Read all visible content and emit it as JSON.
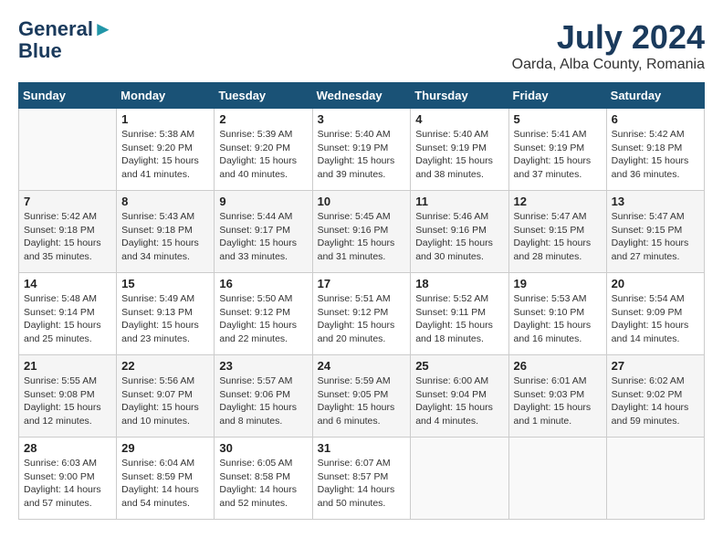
{
  "header": {
    "logo_line1": "General",
    "logo_line2": "Blue",
    "main_title": "July 2024",
    "subtitle": "Oarda, Alba County, Romania"
  },
  "days_of_week": [
    "Sunday",
    "Monday",
    "Tuesday",
    "Wednesday",
    "Thursday",
    "Friday",
    "Saturday"
  ],
  "weeks": [
    [
      {
        "day": "",
        "info": ""
      },
      {
        "day": "1",
        "info": "Sunrise: 5:38 AM\nSunset: 9:20 PM\nDaylight: 15 hours\nand 41 minutes."
      },
      {
        "day": "2",
        "info": "Sunrise: 5:39 AM\nSunset: 9:20 PM\nDaylight: 15 hours\nand 40 minutes."
      },
      {
        "day": "3",
        "info": "Sunrise: 5:40 AM\nSunset: 9:19 PM\nDaylight: 15 hours\nand 39 minutes."
      },
      {
        "day": "4",
        "info": "Sunrise: 5:40 AM\nSunset: 9:19 PM\nDaylight: 15 hours\nand 38 minutes."
      },
      {
        "day": "5",
        "info": "Sunrise: 5:41 AM\nSunset: 9:19 PM\nDaylight: 15 hours\nand 37 minutes."
      },
      {
        "day": "6",
        "info": "Sunrise: 5:42 AM\nSunset: 9:18 PM\nDaylight: 15 hours\nand 36 minutes."
      }
    ],
    [
      {
        "day": "7",
        "info": "Sunrise: 5:42 AM\nSunset: 9:18 PM\nDaylight: 15 hours\nand 35 minutes."
      },
      {
        "day": "8",
        "info": "Sunrise: 5:43 AM\nSunset: 9:18 PM\nDaylight: 15 hours\nand 34 minutes."
      },
      {
        "day": "9",
        "info": "Sunrise: 5:44 AM\nSunset: 9:17 PM\nDaylight: 15 hours\nand 33 minutes."
      },
      {
        "day": "10",
        "info": "Sunrise: 5:45 AM\nSunset: 9:16 PM\nDaylight: 15 hours\nand 31 minutes."
      },
      {
        "day": "11",
        "info": "Sunrise: 5:46 AM\nSunset: 9:16 PM\nDaylight: 15 hours\nand 30 minutes."
      },
      {
        "day": "12",
        "info": "Sunrise: 5:47 AM\nSunset: 9:15 PM\nDaylight: 15 hours\nand 28 minutes."
      },
      {
        "day": "13",
        "info": "Sunrise: 5:47 AM\nSunset: 9:15 PM\nDaylight: 15 hours\nand 27 minutes."
      }
    ],
    [
      {
        "day": "14",
        "info": "Sunrise: 5:48 AM\nSunset: 9:14 PM\nDaylight: 15 hours\nand 25 minutes."
      },
      {
        "day": "15",
        "info": "Sunrise: 5:49 AM\nSunset: 9:13 PM\nDaylight: 15 hours\nand 23 minutes."
      },
      {
        "day": "16",
        "info": "Sunrise: 5:50 AM\nSunset: 9:12 PM\nDaylight: 15 hours\nand 22 minutes."
      },
      {
        "day": "17",
        "info": "Sunrise: 5:51 AM\nSunset: 9:12 PM\nDaylight: 15 hours\nand 20 minutes."
      },
      {
        "day": "18",
        "info": "Sunrise: 5:52 AM\nSunset: 9:11 PM\nDaylight: 15 hours\nand 18 minutes."
      },
      {
        "day": "19",
        "info": "Sunrise: 5:53 AM\nSunset: 9:10 PM\nDaylight: 15 hours\nand 16 minutes."
      },
      {
        "day": "20",
        "info": "Sunrise: 5:54 AM\nSunset: 9:09 PM\nDaylight: 15 hours\nand 14 minutes."
      }
    ],
    [
      {
        "day": "21",
        "info": "Sunrise: 5:55 AM\nSunset: 9:08 PM\nDaylight: 15 hours\nand 12 minutes."
      },
      {
        "day": "22",
        "info": "Sunrise: 5:56 AM\nSunset: 9:07 PM\nDaylight: 15 hours\nand 10 minutes."
      },
      {
        "day": "23",
        "info": "Sunrise: 5:57 AM\nSunset: 9:06 PM\nDaylight: 15 hours\nand 8 minutes."
      },
      {
        "day": "24",
        "info": "Sunrise: 5:59 AM\nSunset: 9:05 PM\nDaylight: 15 hours\nand 6 minutes."
      },
      {
        "day": "25",
        "info": "Sunrise: 6:00 AM\nSunset: 9:04 PM\nDaylight: 15 hours\nand 4 minutes."
      },
      {
        "day": "26",
        "info": "Sunrise: 6:01 AM\nSunset: 9:03 PM\nDaylight: 15 hours\nand 1 minute."
      },
      {
        "day": "27",
        "info": "Sunrise: 6:02 AM\nSunset: 9:02 PM\nDaylight: 14 hours\nand 59 minutes."
      }
    ],
    [
      {
        "day": "28",
        "info": "Sunrise: 6:03 AM\nSunset: 9:00 PM\nDaylight: 14 hours\nand 57 minutes."
      },
      {
        "day": "29",
        "info": "Sunrise: 6:04 AM\nSunset: 8:59 PM\nDaylight: 14 hours\nand 54 minutes."
      },
      {
        "day": "30",
        "info": "Sunrise: 6:05 AM\nSunset: 8:58 PM\nDaylight: 14 hours\nand 52 minutes."
      },
      {
        "day": "31",
        "info": "Sunrise: 6:07 AM\nSunset: 8:57 PM\nDaylight: 14 hours\nand 50 minutes."
      },
      {
        "day": "",
        "info": ""
      },
      {
        "day": "",
        "info": ""
      },
      {
        "day": "",
        "info": ""
      }
    ]
  ]
}
